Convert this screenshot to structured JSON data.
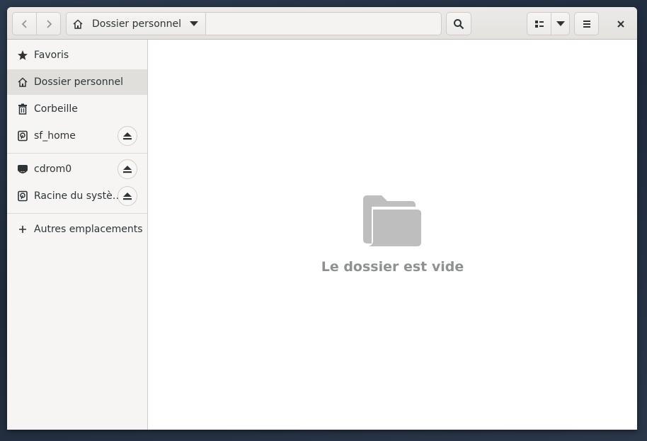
{
  "headerbar": {
    "path": {
      "label": "Dossier personnel",
      "icon": "home-icon"
    }
  },
  "sidebar": {
    "items": [
      {
        "label": "Favoris",
        "icon": "star-icon"
      },
      {
        "label": "Dossier personnel",
        "icon": "home-icon",
        "active": true
      },
      {
        "label": "Corbeille",
        "icon": "trash-icon"
      },
      {
        "label": "sf_home",
        "icon": "drive-icon",
        "eject": true
      },
      {
        "label": "cdrom0",
        "icon": "optical-drive-icon",
        "eject": true
      },
      {
        "label": "Racine du systè…",
        "icon": "drive-icon",
        "eject": true
      },
      {
        "label": "Autres emplacements",
        "icon": "plus-icon"
      }
    ]
  },
  "content": {
    "empty_message": "Le dossier est vide",
    "empty_icon": "folder-icon"
  },
  "colors": {
    "headerbar": "#e8e7e5",
    "sidebar": "#f6f5f4",
    "sidebar_active": "#e1dfdc",
    "empty_text": "#8e9192",
    "folder_icon": "#bebebe"
  }
}
